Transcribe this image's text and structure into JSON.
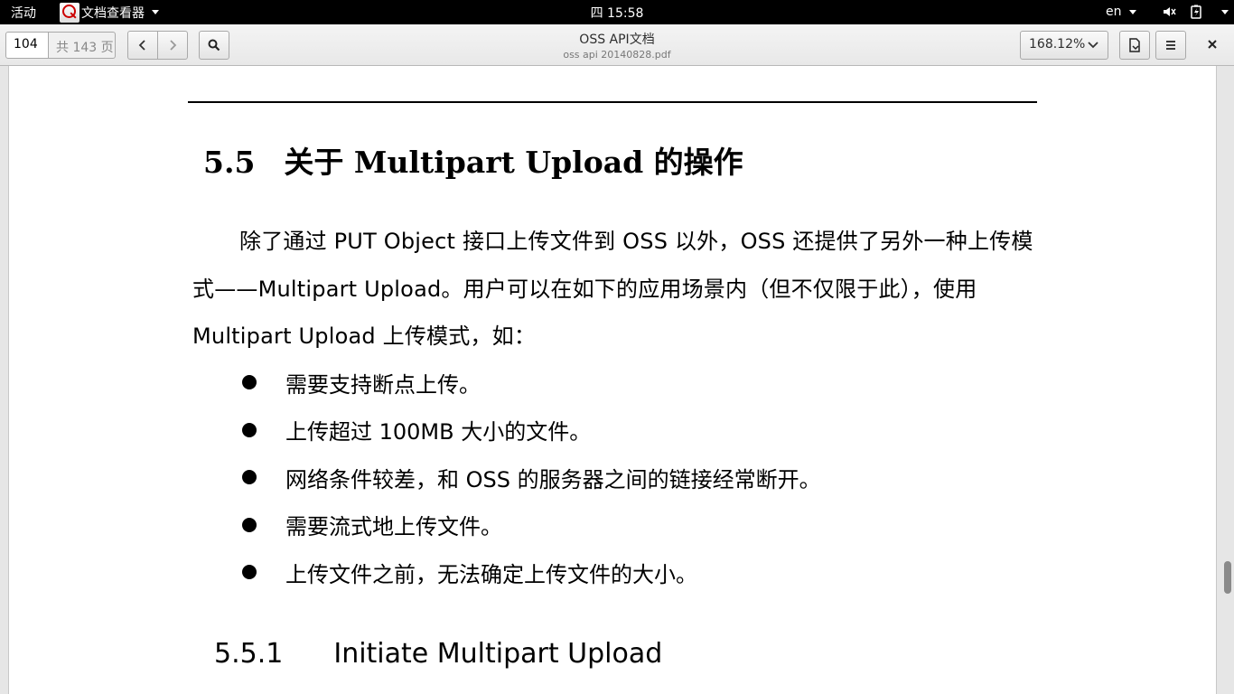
{
  "topbar": {
    "activities": "活动",
    "app_name": "文档查看器",
    "clock": "四 15:58",
    "lang": "en"
  },
  "toolbar": {
    "page_number": "104",
    "page_total": "共 143 页",
    "doc_title": "OSS API文档",
    "doc_file": "oss api 20140828.pdf",
    "zoom": "168.12%"
  },
  "document": {
    "section_number": "5.5",
    "section_title": "关于 Multipart Upload 的操作",
    "paragraph": "除了通过 PUT Object 接口上传文件到 OSS 以外，OSS 还提供了另外一种上传模式——Multipart Upload。用户可以在如下的应用场景内（但不仅限于此），使用 Multipart Upload 上传模式，如：",
    "bullets": [
      "需要支持断点上传。",
      "上传超过 100MB 大小的文件。",
      "网络条件较差，和 OSS 的服务器之间的链接经常断开。",
      "需要流式地上传文件。",
      "上传文件之前，无法确定上传文件的大小。"
    ],
    "subsection_number": "5.5.1",
    "subsection_title": "Initiate Multipart Upload"
  }
}
